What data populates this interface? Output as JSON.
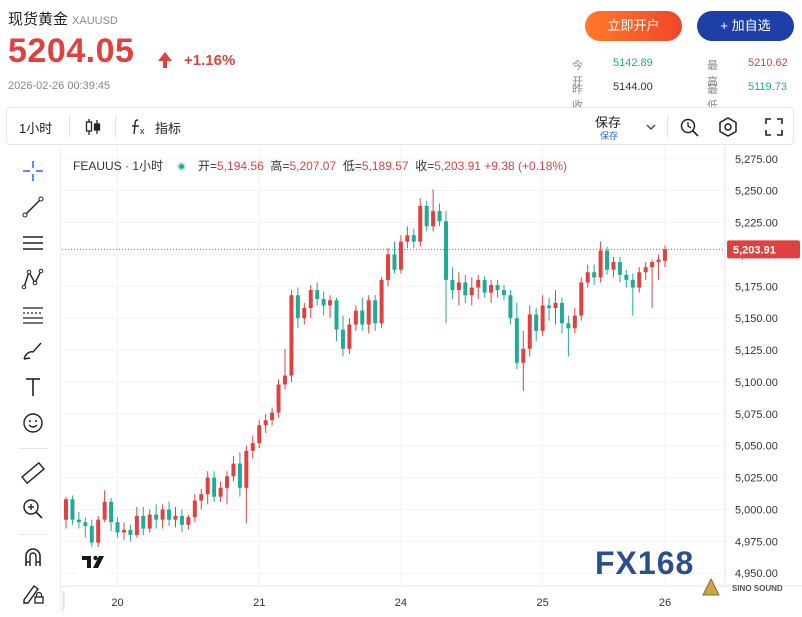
{
  "header": {
    "title": "现货黄金",
    "symbol": "XAUUSD",
    "price": "5204.05",
    "change_pct": "+1.16%",
    "timestamp": "2026-02-26 00:39:45",
    "open_account_label": "立即开户",
    "add_watch_label": "+ 加自选",
    "quotes": [
      {
        "key": "今开",
        "value": "5142.89",
        "color": "#22ab94"
      },
      {
        "key": "最高",
        "value": "5210.62",
        "color": "#e04040"
      },
      {
        "key": "昨收",
        "value": "5144.00",
        "color": "#333333"
      },
      {
        "key": "最低",
        "value": "5119.73",
        "color": "#22ab94"
      }
    ]
  },
  "toolbar": {
    "timeframe": "1小时",
    "indicators_label": "指标",
    "save_label": "保存",
    "save_sub": "保存"
  },
  "legend": {
    "symbol": "FEAUUS · 1小时",
    "open_key": "开=",
    "open": "5,194.56",
    "high_key": "高=",
    "high": "5,207.07",
    "low_key": "低=",
    "low": "5,189.57",
    "close_key": "收=",
    "close": "5,203.91",
    "change": "+9.38",
    "change_pct": "(+0.18%)"
  },
  "watermark": {
    "brand": "FX168",
    "sub": "SINO SOUND"
  },
  "colors": {
    "up": "#22ab94",
    "down": "#e04040",
    "accent": "#2962ff",
    "brand_blue": "#1e3fa8",
    "brand_orange": "#f0462a"
  },
  "icons": [
    "candlestick-icon",
    "function-icon",
    "chevron-down-icon",
    "replay-icon",
    "settings-hex-icon",
    "fullscreen-icon",
    "crosshair-icon",
    "trendline-icon",
    "horizontal-lines-icon",
    "pattern-icon",
    "fib-icon",
    "brush-icon",
    "text-icon",
    "emoji-icon",
    "ruler-icon",
    "zoom-in-icon",
    "magnet-icon",
    "lock-draw-icon",
    "tradingview-logo-icon"
  ],
  "chart_data": {
    "type": "candlestick",
    "title": "",
    "xlabel": "",
    "ylabel": "",
    "x_ticks": [
      "20",
      "21",
      "24",
      "25",
      "26"
    ],
    "y_ticks": [
      "5,275.00",
      "5,250.00",
      "5,225.00",
      "5,200.00",
      "5,175.00",
      "5,150.00",
      "5,125.00",
      "5,100.00",
      "5,075.00",
      "5,050.00",
      "5,025.00",
      "5,000.00",
      "4,975.00",
      "4,950.00"
    ],
    "ylim": [
      4940,
      5285
    ],
    "last_price": 5203.91,
    "last_price_label": "5,203.91",
    "series": [
      {
        "o": 4992,
        "h": 5010,
        "l": 4985,
        "c": 5008
      },
      {
        "o": 5008,
        "h": 5011,
        "l": 4988,
        "c": 4992
      },
      {
        "o": 4992,
        "h": 4998,
        "l": 4985,
        "c": 4990
      },
      {
        "o": 4990,
        "h": 4994,
        "l": 4978,
        "c": 4987
      },
      {
        "o": 4987,
        "h": 4992,
        "l": 4968,
        "c": 4974
      },
      {
        "o": 4974,
        "h": 4995,
        "l": 4970,
        "c": 4992
      },
      {
        "o": 4992,
        "h": 5015,
        "l": 4990,
        "c": 5006
      },
      {
        "o": 5006,
        "h": 5009,
        "l": 4983,
        "c": 4990
      },
      {
        "o": 4990,
        "h": 4994,
        "l": 4978,
        "c": 4982
      },
      {
        "o": 4982,
        "h": 4990,
        "l": 4976,
        "c": 4984
      },
      {
        "o": 4984,
        "h": 4988,
        "l": 4975,
        "c": 4980
      },
      {
        "o": 4980,
        "h": 5002,
        "l": 4978,
        "c": 4995
      },
      {
        "o": 4995,
        "h": 5002,
        "l": 4980,
        "c": 4985
      },
      {
        "o": 4985,
        "h": 5000,
        "l": 4982,
        "c": 4996
      },
      {
        "o": 4996,
        "h": 5004,
        "l": 4985,
        "c": 4992
      },
      {
        "o": 4992,
        "h": 5004,
        "l": 4985,
        "c": 5000
      },
      {
        "o": 5000,
        "h": 5006,
        "l": 4987,
        "c": 4992
      },
      {
        "o": 4992,
        "h": 5002,
        "l": 4986,
        "c": 4995
      },
      {
        "o": 4995,
        "h": 5000,
        "l": 4982,
        "c": 4988
      },
      {
        "o": 4988,
        "h": 4996,
        "l": 4984,
        "c": 4994
      },
      {
        "o": 4994,
        "h": 5012,
        "l": 4990,
        "c": 5007
      },
      {
        "o": 5007,
        "h": 5016,
        "l": 5000,
        "c": 5012
      },
      {
        "o": 5012,
        "h": 5030,
        "l": 5004,
        "c": 5025
      },
      {
        "o": 5025,
        "h": 5030,
        "l": 5006,
        "c": 5010
      },
      {
        "o": 5010,
        "h": 5022,
        "l": 5006,
        "c": 5017
      },
      {
        "o": 5017,
        "h": 5030,
        "l": 5004,
        "c": 5026
      },
      {
        "o": 5026,
        "h": 5042,
        "l": 5022,
        "c": 5036
      },
      {
        "o": 5036,
        "h": 5045,
        "l": 5010,
        "c": 5017
      },
      {
        "o": 5017,
        "h": 5050,
        "l": 4989,
        "c": 5046
      },
      {
        "o": 5046,
        "h": 5058,
        "l": 5040,
        "c": 5052
      },
      {
        "o": 5052,
        "h": 5070,
        "l": 5048,
        "c": 5066
      },
      {
        "o": 5066,
        "h": 5075,
        "l": 5060,
        "c": 5070
      },
      {
        "o": 5070,
        "h": 5080,
        "l": 5066,
        "c": 5076
      },
      {
        "o": 5076,
        "h": 5102,
        "l": 5072,
        "c": 5098
      },
      {
        "o": 5098,
        "h": 5126,
        "l": 5094,
        "c": 5105
      },
      {
        "o": 5105,
        "h": 5172,
        "l": 5100,
        "c": 5168
      },
      {
        "o": 5168,
        "h": 5174,
        "l": 5142,
        "c": 5150
      },
      {
        "o": 5150,
        "h": 5162,
        "l": 5145,
        "c": 5158
      },
      {
        "o": 5158,
        "h": 5176,
        "l": 5150,
        "c": 5172
      },
      {
        "o": 5172,
        "h": 5178,
        "l": 5160,
        "c": 5165
      },
      {
        "o": 5165,
        "h": 5171,
        "l": 5152,
        "c": 5160
      },
      {
        "o": 5160,
        "h": 5168,
        "l": 5150,
        "c": 5164
      },
      {
        "o": 5164,
        "h": 5166,
        "l": 5132,
        "c": 5141
      },
      {
        "o": 5141,
        "h": 5152,
        "l": 5120,
        "c": 5126
      },
      {
        "o": 5126,
        "h": 5150,
        "l": 5122,
        "c": 5145
      },
      {
        "o": 5145,
        "h": 5160,
        "l": 5140,
        "c": 5156
      },
      {
        "o": 5156,
        "h": 5166,
        "l": 5140,
        "c": 5145
      },
      {
        "o": 5145,
        "h": 5168,
        "l": 5138,
        "c": 5164
      },
      {
        "o": 5164,
        "h": 5168,
        "l": 5140,
        "c": 5146
      },
      {
        "o": 5146,
        "h": 5182,
        "l": 5142,
        "c": 5180
      },
      {
        "o": 5180,
        "h": 5205,
        "l": 5175,
        "c": 5200
      },
      {
        "o": 5200,
        "h": 5210,
        "l": 5185,
        "c": 5188
      },
      {
        "o": 5188,
        "h": 5215,
        "l": 5185,
        "c": 5210
      },
      {
        "o": 5210,
        "h": 5222,
        "l": 5205,
        "c": 5215
      },
      {
        "o": 5215,
        "h": 5220,
        "l": 5205,
        "c": 5210
      },
      {
        "o": 5210,
        "h": 5244,
        "l": 5206,
        "c": 5238
      },
      {
        "o": 5238,
        "h": 5242,
        "l": 5218,
        "c": 5222
      },
      {
        "o": 5222,
        "h": 5251,
        "l": 5218,
        "c": 5234
      },
      {
        "o": 5234,
        "h": 5240,
        "l": 5222,
        "c": 5226
      },
      {
        "o": 5226,
        "h": 5234,
        "l": 5146,
        "c": 5180
      },
      {
        "o": 5180,
        "h": 5190,
        "l": 5165,
        "c": 5172
      },
      {
        "o": 5172,
        "h": 5186,
        "l": 5160,
        "c": 5178
      },
      {
        "o": 5178,
        "h": 5184,
        "l": 5162,
        "c": 5168
      },
      {
        "o": 5168,
        "h": 5182,
        "l": 5160,
        "c": 5174
      },
      {
        "o": 5174,
        "h": 5184,
        "l": 5165,
        "c": 5180
      },
      {
        "o": 5180,
        "h": 5183,
        "l": 5166,
        "c": 5170
      },
      {
        "o": 5170,
        "h": 5180,
        "l": 5162,
        "c": 5176
      },
      {
        "o": 5176,
        "h": 5180,
        "l": 5166,
        "c": 5172
      },
      {
        "o": 5172,
        "h": 5176,
        "l": 5164,
        "c": 5168
      },
      {
        "o": 5168,
        "h": 5172,
        "l": 5145,
        "c": 5150
      },
      {
        "o": 5150,
        "h": 5162,
        "l": 5110,
        "c": 5115
      },
      {
        "o": 5115,
        "h": 5140,
        "l": 5093,
        "c": 5126
      },
      {
        "o": 5126,
        "h": 5160,
        "l": 5120,
        "c": 5153
      },
      {
        "o": 5153,
        "h": 5158,
        "l": 5132,
        "c": 5140
      },
      {
        "o": 5140,
        "h": 5168,
        "l": 5136,
        "c": 5160
      },
      {
        "o": 5160,
        "h": 5166,
        "l": 5148,
        "c": 5158
      },
      {
        "o": 5158,
        "h": 5172,
        "l": 5145,
        "c": 5162
      },
      {
        "o": 5162,
        "h": 5166,
        "l": 5138,
        "c": 5146
      },
      {
        "o": 5146,
        "h": 5152,
        "l": 5120,
        "c": 5142
      },
      {
        "o": 5142,
        "h": 5158,
        "l": 5138,
        "c": 5152
      },
      {
        "o": 5152,
        "h": 5182,
        "l": 5148,
        "c": 5178
      },
      {
        "o": 5178,
        "h": 5192,
        "l": 5174,
        "c": 5186
      },
      {
        "o": 5186,
        "h": 5192,
        "l": 5176,
        "c": 5182
      },
      {
        "o": 5182,
        "h": 5210,
        "l": 5178,
        "c": 5203
      },
      {
        "o": 5203,
        "h": 5206,
        "l": 5184,
        "c": 5188
      },
      {
        "o": 5188,
        "h": 5198,
        "l": 5182,
        "c": 5194
      },
      {
        "o": 5194,
        "h": 5198,
        "l": 5178,
        "c": 5184
      },
      {
        "o": 5184,
        "h": 5188,
        "l": 5174,
        "c": 5180
      },
      {
        "o": 5180,
        "h": 5185,
        "l": 5152,
        "c": 5174
      },
      {
        "o": 5174,
        "h": 5190,
        "l": 5170,
        "c": 5186
      },
      {
        "o": 5186,
        "h": 5194,
        "l": 5180,
        "c": 5190
      },
      {
        "o": 5190,
        "h": 5196,
        "l": 5158,
        "c": 5194
      },
      {
        "o": 5194,
        "h": 5200,
        "l": 5180,
        "c": 5196
      },
      {
        "o": 5195,
        "h": 5207,
        "l": 5190,
        "c": 5204
      }
    ]
  }
}
